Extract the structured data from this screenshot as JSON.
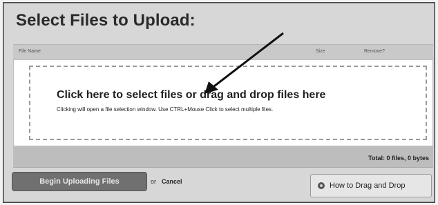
{
  "header": {
    "title": "Select Files to Upload:"
  },
  "columns": {
    "name": "File Name",
    "size": "Size",
    "remove": "Remove?"
  },
  "dropzone": {
    "main_text": "Click here to select files or drag and drop files here",
    "sub_text": "Clicking will open a file selection window. Use CTRL+Mouse Click to select multiple files."
  },
  "totals": {
    "text": "Total: 0 files, 0 bytes"
  },
  "footer": {
    "upload_label": "Begin Uploading Files",
    "or_text": "or",
    "cancel_label": "Cancel",
    "help_label": "How to Drag and Drop"
  },
  "icons": {
    "arrow": "arrow-pointer-icon",
    "help": "help-circle-icon"
  }
}
